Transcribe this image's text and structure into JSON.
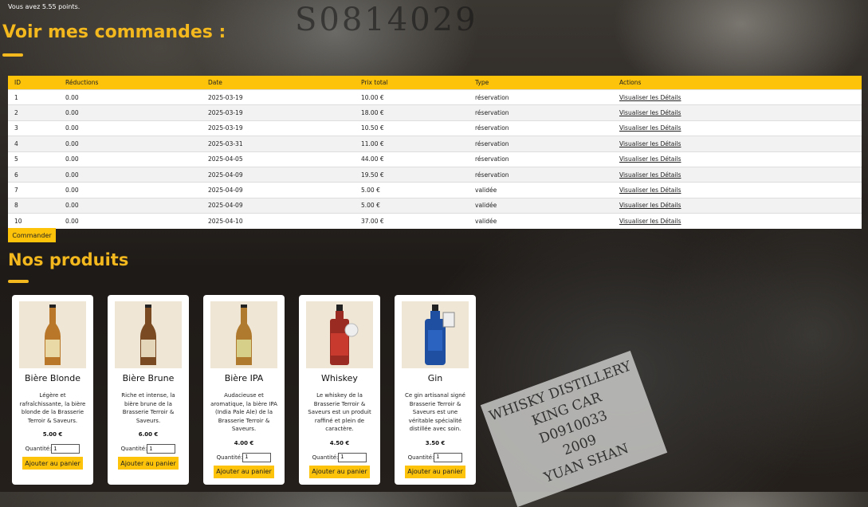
{
  "points_text": "Vous avez 5.55 points.",
  "orders_title": "Voir mes commandes :",
  "orders_table": {
    "headers": [
      "ID",
      "Réductions",
      "Date",
      "Prix total",
      "Type",
      "Actions"
    ],
    "rows": [
      {
        "id": "1",
        "reduction": "0.00",
        "date": "2025-03-19",
        "total": "10.00 €",
        "type": "réservation",
        "action": "Visualiser les Détails"
      },
      {
        "id": "2",
        "reduction": "0.00",
        "date": "2025-03-19",
        "total": "18.00 €",
        "type": "réservation",
        "action": "Visualiser les Détails"
      },
      {
        "id": "3",
        "reduction": "0.00",
        "date": "2025-03-19",
        "total": "10.50 €",
        "type": "réservation",
        "action": "Visualiser les Détails"
      },
      {
        "id": "4",
        "reduction": "0.00",
        "date": "2025-03-31",
        "total": "11.00 €",
        "type": "réservation",
        "action": "Visualiser les Détails"
      },
      {
        "id": "5",
        "reduction": "0.00",
        "date": "2025-04-05",
        "total": "44.00 €",
        "type": "réservation",
        "action": "Visualiser les Détails"
      },
      {
        "id": "6",
        "reduction": "0.00",
        "date": "2025-04-09",
        "total": "19.50 €",
        "type": "réservation",
        "action": "Visualiser les Détails"
      },
      {
        "id": "7",
        "reduction": "0.00",
        "date": "2025-04-09",
        "total": "5.00 €",
        "type": "validée",
        "action": "Visualiser les Détails"
      },
      {
        "id": "8",
        "reduction": "0.00",
        "date": "2025-04-09",
        "total": "5.00 €",
        "type": "validée",
        "action": "Visualiser les Détails"
      },
      {
        "id": "10",
        "reduction": "0.00",
        "date": "2025-04-10",
        "total": "37.00 €",
        "type": "validée",
        "action": "Visualiser les Détails"
      }
    ]
  },
  "order_button_label": "Commander",
  "products_title": "Nos produits",
  "quantity_label": "Quantité:",
  "add_to_cart_label": "Ajouter au panier",
  "products": [
    {
      "name": "Bière Blonde",
      "description": "Légère et rafraîchissante, la bière blonde de la Brasserie Terroir & Saveurs.",
      "price": "5.00 €",
      "quantity": "1",
      "bottle_color": "#b9772a",
      "label_color": "#e9d9a6"
    },
    {
      "name": "Bière Brune",
      "description": "Riche et intense, la bière brune de la Brasserie Terroir & Saveurs.",
      "price": "6.00 €",
      "quantity": "1",
      "bottle_color": "#7a4a22",
      "label_color": "#e4d6b8"
    },
    {
      "name": "Bière IPA",
      "description": "Audacieuse et aromatique, la bière IPA (India Pale Ale) de la Brasserie Terroir & Saveurs.",
      "price": "4.00 €",
      "quantity": "1",
      "bottle_color": "#b07a2e",
      "label_color": "#d6cf8a"
    },
    {
      "name": "Whiskey",
      "description": "Le whiskey de la Brasserie Terroir & Saveurs est un produit raffiné et plein de caractère.",
      "price": "4.50 €",
      "quantity": "1",
      "bottle_color": "#9a2b22",
      "label_color": "#c83a2e"
    },
    {
      "name": "Gin",
      "description": "Ce gin artisanal signé Brasserie Terroir & Saveurs est une véritable spécialité distillée avec soin.",
      "price": "3.50 €",
      "quantity": "1",
      "bottle_color": "#1f4fa0",
      "label_color": "#2a63c0"
    }
  ],
  "background_label_lines": [
    "WHISKY DISTILLERY",
    "KING CAR",
    "D0910033",
    "2009",
    "YUAN SHAN"
  ],
  "background_stencil": "S0814029",
  "colors": {
    "accent": "#f3b81d",
    "button": "#fcc30a"
  }
}
